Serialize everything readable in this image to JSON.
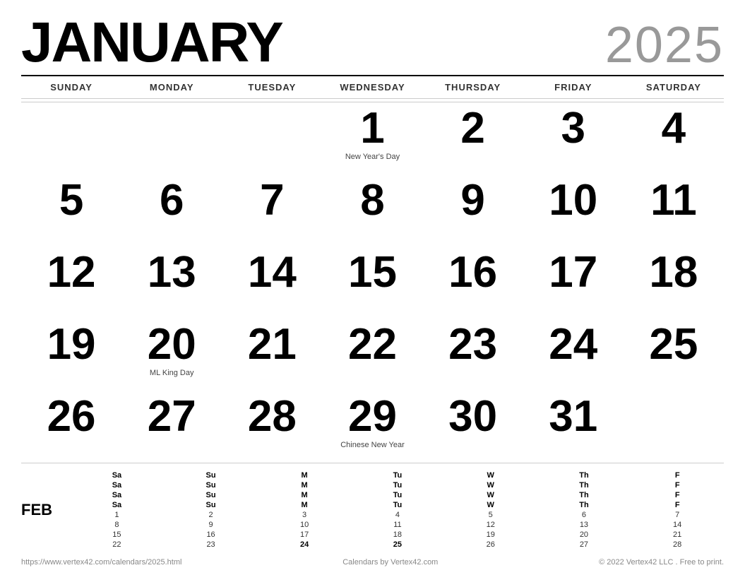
{
  "header": {
    "month": "JANUARY",
    "year": "2025"
  },
  "day_headers": [
    "SUNDAY",
    "MONDAY",
    "TUESDAY",
    "WEDNESDAY",
    "THURSDAY",
    "FRIDAY",
    "SATURDAY"
  ],
  "weeks": [
    [
      {
        "day": "",
        "holiday": ""
      },
      {
        "day": "",
        "holiday": ""
      },
      {
        "day": "",
        "holiday": ""
      },
      {
        "day": "1",
        "holiday": "New Year's Day"
      },
      {
        "day": "2",
        "holiday": ""
      },
      {
        "day": "3",
        "holiday": ""
      },
      {
        "day": "4",
        "holiday": ""
      }
    ],
    [
      {
        "day": "5",
        "holiday": ""
      },
      {
        "day": "6",
        "holiday": ""
      },
      {
        "day": "7",
        "holiday": ""
      },
      {
        "day": "8",
        "holiday": ""
      },
      {
        "day": "9",
        "holiday": ""
      },
      {
        "day": "10",
        "holiday": ""
      },
      {
        "day": "11",
        "holiday": ""
      }
    ],
    [
      {
        "day": "12",
        "holiday": ""
      },
      {
        "day": "13",
        "holiday": ""
      },
      {
        "day": "14",
        "holiday": ""
      },
      {
        "day": "15",
        "holiday": ""
      },
      {
        "day": "16",
        "holiday": ""
      },
      {
        "day": "17",
        "holiday": ""
      },
      {
        "day": "18",
        "holiday": ""
      }
    ],
    [
      {
        "day": "19",
        "holiday": ""
      },
      {
        "day": "20",
        "holiday": "ML King Day"
      },
      {
        "day": "21",
        "holiday": ""
      },
      {
        "day": "22",
        "holiday": ""
      },
      {
        "day": "23",
        "holiday": ""
      },
      {
        "day": "24",
        "holiday": ""
      },
      {
        "day": "25",
        "holiday": ""
      }
    ],
    [
      {
        "day": "26",
        "holiday": ""
      },
      {
        "day": "27",
        "holiday": ""
      },
      {
        "day": "28",
        "holiday": ""
      },
      {
        "day": "29",
        "holiday": "Chinese New Year"
      },
      {
        "day": "30",
        "holiday": ""
      },
      {
        "day": "31",
        "holiday": ""
      },
      {
        "day": "",
        "holiday": ""
      }
    ]
  ],
  "mini_cal": {
    "month_label": "FEB",
    "headers": [
      "Sa",
      "Su",
      "M",
      "Tu",
      "W",
      "Th",
      "F",
      "Sa",
      "Su",
      "M",
      "Tu",
      "W",
      "Th",
      "F",
      "Sa",
      "Su",
      "M",
      "Tu",
      "W",
      "Th",
      "F",
      "Sa",
      "Su",
      "M",
      "Tu",
      "W",
      "Th",
      "F"
    ],
    "days": [
      "1",
      "2",
      "3",
      "4",
      "5",
      "6",
      "7",
      "8",
      "9",
      "10",
      "11",
      "12",
      "13",
      "14",
      "15",
      "16",
      "17",
      "18",
      "19",
      "20",
      "21",
      "22",
      "23",
      "24",
      "25",
      "26",
      "27",
      "28"
    ],
    "bold_days": [
      "24",
      "25"
    ]
  },
  "footer": {
    "url": "https://www.vertex42.com/calendars/2025.html",
    "center": "Calendars by Vertex42.com",
    "right": "© 2022 Vertex42 LLC . Free to print."
  }
}
